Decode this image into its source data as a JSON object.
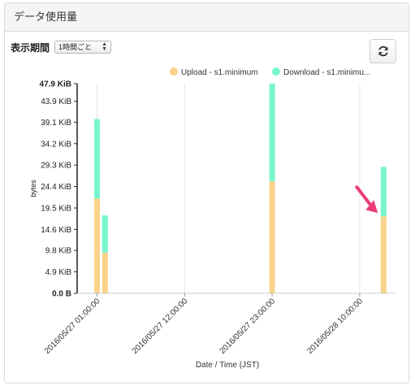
{
  "panel": {
    "title": "データ使用量"
  },
  "toolbar": {
    "period_label": "表示期間",
    "period_selected": "1時間ごと",
    "refresh_icon": "refresh-icon"
  },
  "colors": {
    "upload": "#fad38a",
    "download": "#78f5cf",
    "arrow": "#ea3d74",
    "grid": "#e6e6e6",
    "axis": "#222222"
  },
  "chart_data": {
    "type": "bar",
    "stacked": true,
    "ylabel": "bytes",
    "xlabel": "Date / Time (JST)",
    "ylim": [
      0,
      47.9
    ],
    "y_unit": "KiB",
    "y_ticks": [
      "0.0 B",
      "4.9 KiB",
      "9.8 KiB",
      "14.6 KiB",
      "19.5 KiB",
      "24.4 KiB",
      "29.3 KiB",
      "34.2 KiB",
      "39.1 KiB",
      "43.9 KiB",
      "47.9 KiB"
    ],
    "y_tick_values": [
      0,
      4.9,
      9.8,
      14.6,
      19.5,
      24.4,
      29.3,
      34.2,
      39.1,
      43.9,
      47.9
    ],
    "x_ticks": [
      "2016/05/27 01:00:00",
      "2016/05/27 12:00:00",
      "2016/05/27 23:00:00",
      "2016/05/28 10:00:00"
    ],
    "x_tick_hours": [
      1,
      12,
      23,
      34
    ],
    "x_range_hours": [
      -1.5,
      38.5
    ],
    "legend_position": "top-right",
    "series": [
      {
        "name": "Upload - s1.minimum",
        "key": "upload",
        "values": [
          21.7,
          9.3,
          25.6,
          17.6
        ]
      },
      {
        "name": "Download - s1.minimum",
        "key": "download",
        "values": [
          18.1,
          8.5,
          22.3,
          11.3
        ]
      }
    ],
    "bar_hours": [
      1,
      2,
      23,
      37
    ]
  },
  "annotation": {
    "arrow_target": "last bar",
    "arrow_color": "#ea3d74"
  }
}
